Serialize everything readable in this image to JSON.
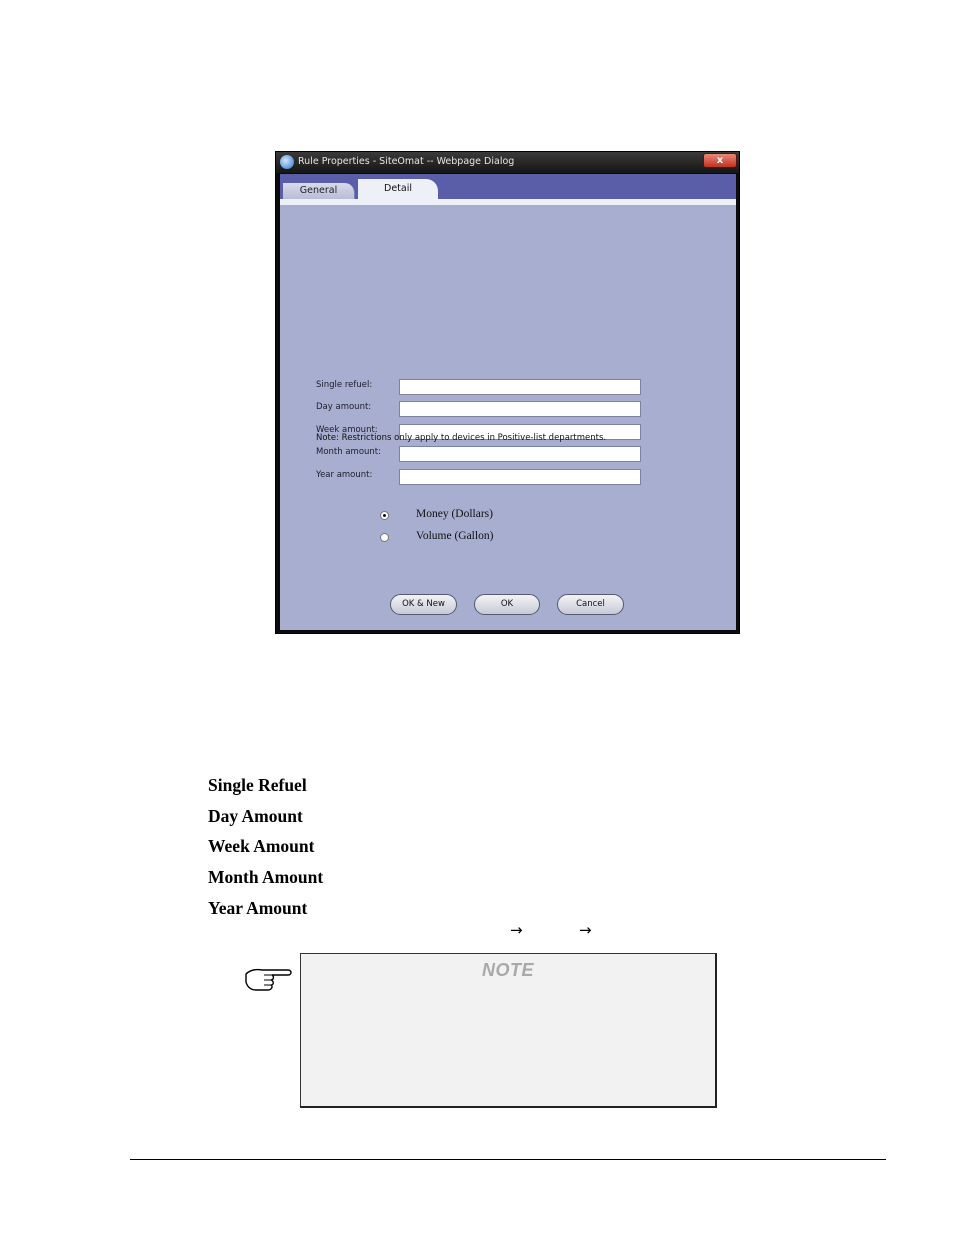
{
  "dialog": {
    "title": "Rule Properties - SiteOmat -- Webpage Dialog",
    "close_label": "x",
    "tabs": [
      {
        "label": "General"
      },
      {
        "label": "Detail"
      }
    ],
    "fields": [
      {
        "label": "Single refuel:",
        "value": ""
      },
      {
        "label": "Day amount:",
        "value": ""
      },
      {
        "label": "Week amount:",
        "value": ""
      },
      {
        "label": "Month amount:",
        "value": ""
      },
      {
        "label": "Year amount:",
        "value": ""
      }
    ],
    "radios": [
      {
        "label": "Money (Dollars)",
        "selected": true
      },
      {
        "label": "Volume (Gallon)",
        "selected": false
      }
    ],
    "note": "Note: Restrictions only apply to devices in Positive-list departments.",
    "buttons": {
      "ok_new": "OK & New",
      "ok": "OK",
      "cancel": "Cancel"
    }
  },
  "document": {
    "field_titles": [
      "Single Refuel",
      "Day Amount",
      "Week Amount",
      "Month Amount",
      "Year Amount"
    ],
    "arrows": [
      "→",
      "→"
    ],
    "note_heading": "NOTE"
  }
}
